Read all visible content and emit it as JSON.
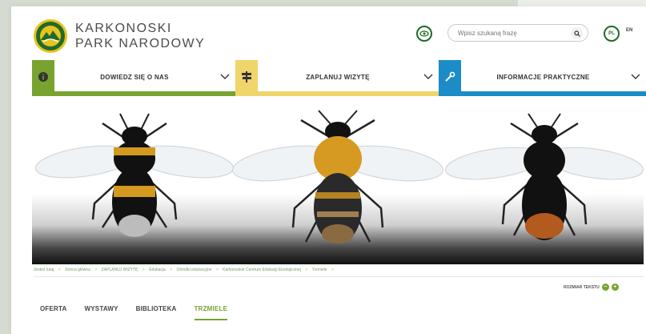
{
  "header": {
    "brand_line1": "KARKONOSKI",
    "brand_line2": "PARK NARODOWY",
    "search_placeholder": "Wpisz szukaną frazę",
    "lang_pl": "PL",
    "lang_en": "EN"
  },
  "nav": [
    {
      "label": "DOWIEDZ SIĘ O NAS",
      "color": "#78a32f",
      "icon": "info-icon"
    },
    {
      "label": "ZAPLANUJ WIZYTĘ",
      "color": "#f0d56a",
      "icon": "signpost-icon"
    },
    {
      "label": "INFORMACJE PRAKTYCZNE",
      "color": "#1b8cc6",
      "icon": "wrench-icon"
    }
  ],
  "breadcrumb": {
    "items": [
      "Jesteś tutaj",
      "Strona główna",
      "ZAPLANUJ WIZYTĘ",
      "Edukacja",
      "Ośrodki edukacyjne",
      "Karkonoskie Centrum Edukacji Ekologicznej",
      "Trzmiele"
    ],
    "separator": ">"
  },
  "text_resize": {
    "label": "ROZMIAR TEKSTU",
    "decrease": "−",
    "increase": "+"
  },
  "tabs": [
    {
      "label": "OFERTA",
      "active": false
    },
    {
      "label": "WYSTAWY",
      "active": false
    },
    {
      "label": "BIBLIOTEKA",
      "active": false
    },
    {
      "label": "TRZMIELE",
      "active": true
    }
  ],
  "colors": {
    "green": "#78a32f",
    "yellow": "#f0d56a",
    "blue": "#1b8cc6",
    "dark_green": "#1f6b2a"
  }
}
